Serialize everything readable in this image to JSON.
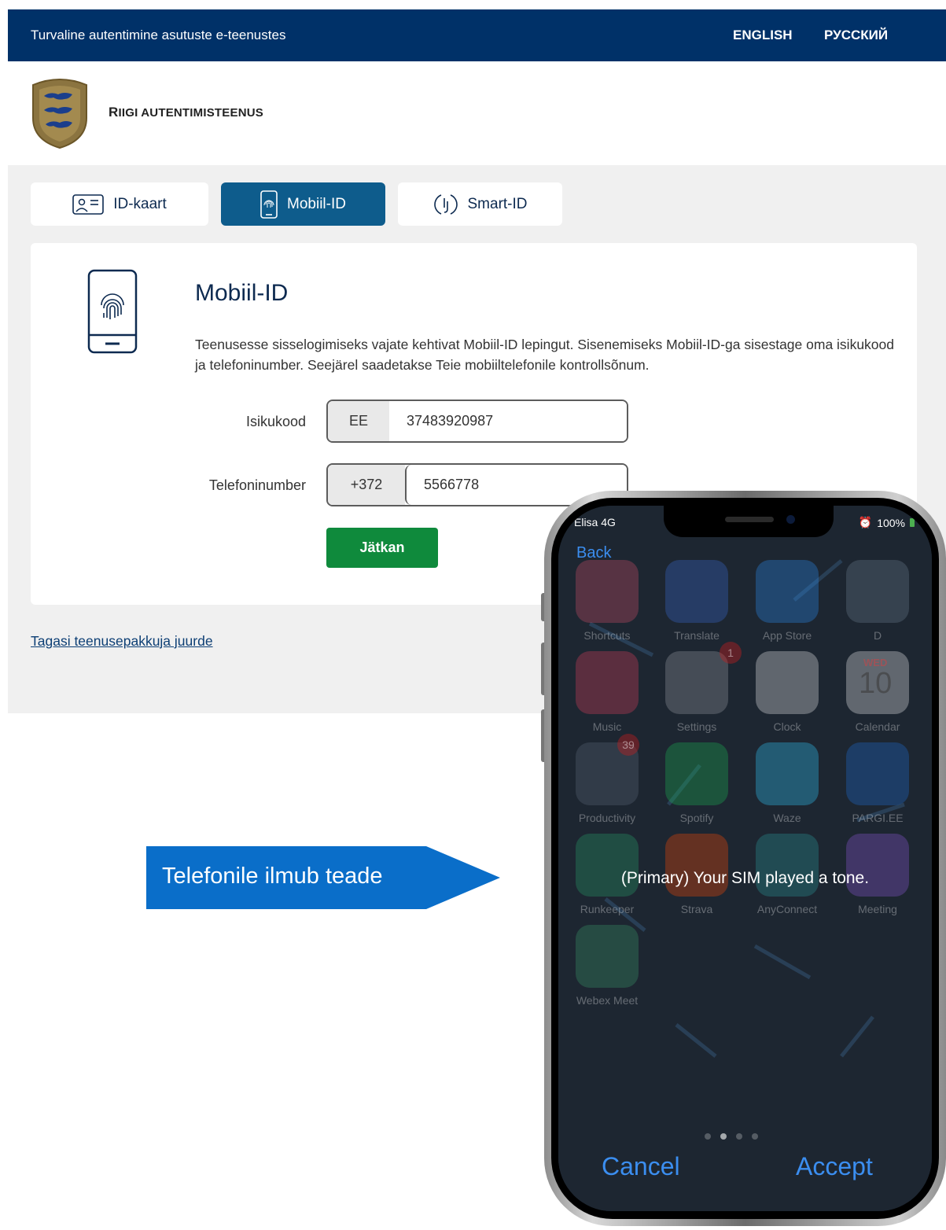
{
  "topbar": {
    "tagline": "Turvaline autentimine asutuste e-teenustes",
    "lang_en": "ENGLISH",
    "lang_ru": "РУССКИЙ"
  },
  "header": {
    "brand_first": "R",
    "brand_rest": "IIGI AUTENTIMISTEENUS",
    "logo": "estonian-coat-of-arms"
  },
  "tabs": [
    {
      "label": "ID-kaart",
      "icon": "id-card-icon",
      "active": false
    },
    {
      "label": "Mobiil-ID",
      "icon": "mobile-fingerprint-icon",
      "active": true
    },
    {
      "label": "Smart-ID",
      "icon": "smart-id-icon",
      "active": false
    }
  ],
  "card": {
    "title": "Mobiil-ID",
    "description": "Teenusesse sisselogimiseks vajate kehtivat Mobiil-ID lepingut. Sisenemiseks Mobiil-ID-ga sisestage oma isikukood ja telefoninumber. Seejärel saadetakse Teie mobiiltelefonile kontrollsõnum.",
    "isikukood_label": "Isikukood",
    "isikukood_prefix": "EE",
    "isikukood_value": "37483920987",
    "telefon_label": "Telefoninumber",
    "telefon_prefix": "+372",
    "telefon_value": "5566778",
    "submit_label": "Jätkan"
  },
  "back_link": "Tagasi teenusepakkuja juurde",
  "callout": {
    "text": "Telefonile ilmub teade",
    "color": "#0a6ec9"
  },
  "phone": {
    "carrier": "Elisa  4G",
    "battery": "100%",
    "back": "Back",
    "message": "(Primary) Your SIM played a tone.",
    "cancel": "Cancel",
    "accept": "Accept",
    "apps": [
      {
        "label": "Shortcuts"
      },
      {
        "label": "Translate"
      },
      {
        "label": "App Store"
      },
      {
        "label": "D"
      },
      {
        "label": "Music"
      },
      {
        "label": "Settings",
        "badge": "1"
      },
      {
        "label": "Clock"
      },
      {
        "label": "Calendar",
        "day": "WED",
        "date": "10"
      },
      {
        "label": "Productivity",
        "badge": "39"
      },
      {
        "label": "Spotify"
      },
      {
        "label": "Waze"
      },
      {
        "label": "PARGI.EE"
      },
      {
        "label": "Runkeeper"
      },
      {
        "label": "Strava"
      },
      {
        "label": "AnyConnect"
      },
      {
        "label": "Meeting"
      },
      {
        "label": "Webex Meet"
      }
    ]
  },
  "colors": {
    "topbar": "#003168",
    "active_tab": "#0e5c8c",
    "submit": "#0f8a3c",
    "ios_blue": "#3b8ef0"
  }
}
